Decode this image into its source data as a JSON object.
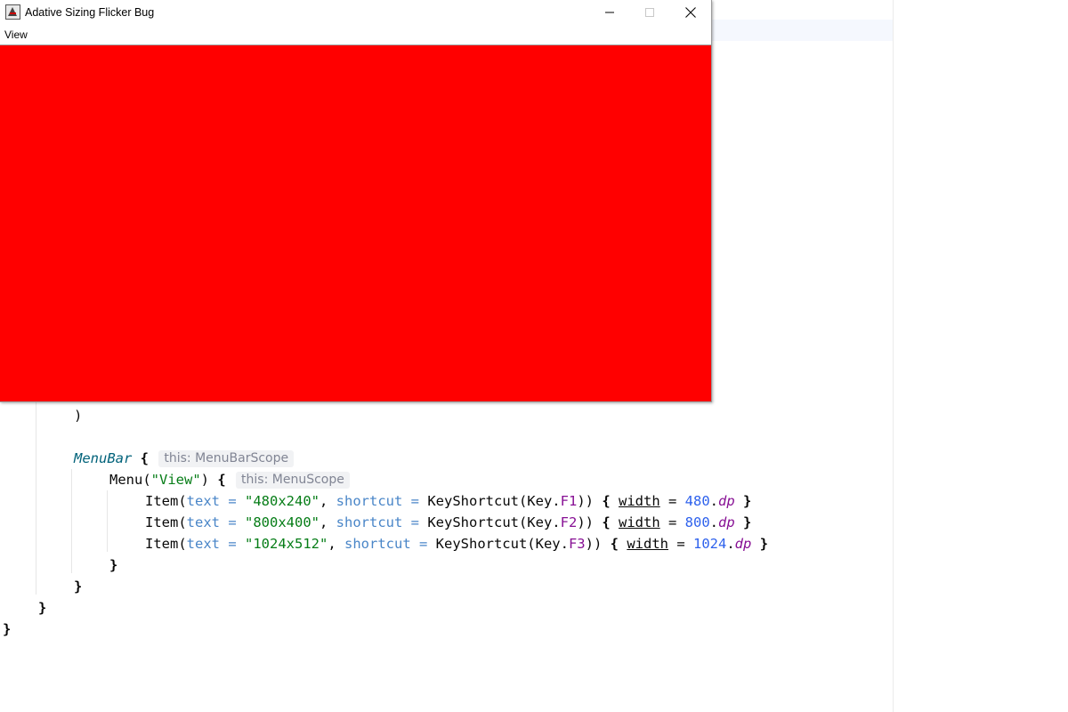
{
  "window": {
    "title": "Adative Sizing Flicker Bug",
    "menu": [
      "View"
    ],
    "content_color": "#ff0000",
    "icons": {
      "app": "java-app-icon",
      "minimize": "minimize-icon",
      "maximize": "maximize-icon",
      "close": "close-icon"
    }
  },
  "editor": {
    "hints": {
      "menubar_scope": "this: MenuBarScope",
      "menu_scope": "this: MenuScope"
    },
    "lines": {
      "paren_close": ")",
      "menubar_name": "MenuBar",
      "menu_call": "Menu(",
      "menu_arg": "\"View\"",
      "menu_close": ")",
      "open_brace": "{",
      "close_brace": "}",
      "item_kw": "Item(",
      "text_param": "text",
      "eq": " = ",
      "shortcut_param": "shortcut",
      "keyshortcut": "KeyShortcut(Key.",
      "width_prop": "width",
      "dp": "dp",
      "comma": ", ",
      "items": [
        {
          "text": "\"480x240\"",
          "key": "F1",
          "width": "480"
        },
        {
          "text": "\"800x400\"",
          "key": "F2",
          "width": "800"
        },
        {
          "text": "\"1024x512\"",
          "key": "F3",
          "width": "1024"
        }
      ]
    }
  }
}
